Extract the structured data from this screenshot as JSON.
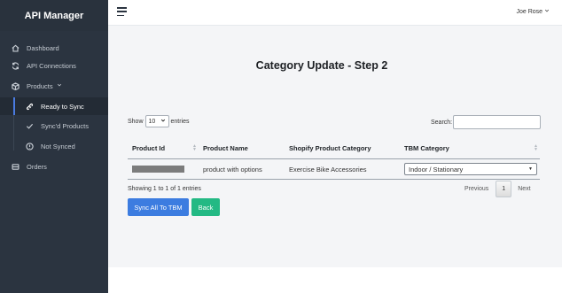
{
  "app": {
    "title": "API Manager"
  },
  "sidebar": {
    "items": [
      {
        "label": "Dashboard",
        "icon": "home-icon"
      },
      {
        "label": "API Connections",
        "icon": "sync-icon"
      },
      {
        "label": "Products",
        "icon": "box-icon"
      },
      {
        "label": "Ready to Sync",
        "icon": "link-icon",
        "active": true
      },
      {
        "label": "Sync'd Products",
        "icon": "check-icon"
      },
      {
        "label": "Not Synced",
        "icon": "info-circle-icon"
      },
      {
        "label": "Orders",
        "icon": "list-icon"
      }
    ]
  },
  "header": {
    "user": "Joe Rose"
  },
  "page": {
    "title": "Category Update - Step 2"
  },
  "table_controls": {
    "show_label": "Show",
    "entries_value": "10",
    "entries_label": "entries",
    "search_label": "Search:"
  },
  "table": {
    "columns": [
      "Product Id",
      "Product Name",
      "Shopify Product Category",
      "TBM Category"
    ],
    "rows": [
      {
        "product_name": "product with options",
        "shopify_category": "Exercise Bike Accessories",
        "tbm_category": "Indoor / Stationary"
      }
    ]
  },
  "pagination": {
    "info": "Showing 1 to 1 of 1 entries",
    "previous": "Previous",
    "current": "1",
    "next": "Next"
  },
  "buttons": {
    "sync_all": "Sync All To TBM",
    "back": "Back"
  },
  "colors": {
    "sidebar": "#2b3440",
    "primary": "#3c7ce0",
    "success": "#23b984",
    "content_bg": "#f4f5f7"
  }
}
